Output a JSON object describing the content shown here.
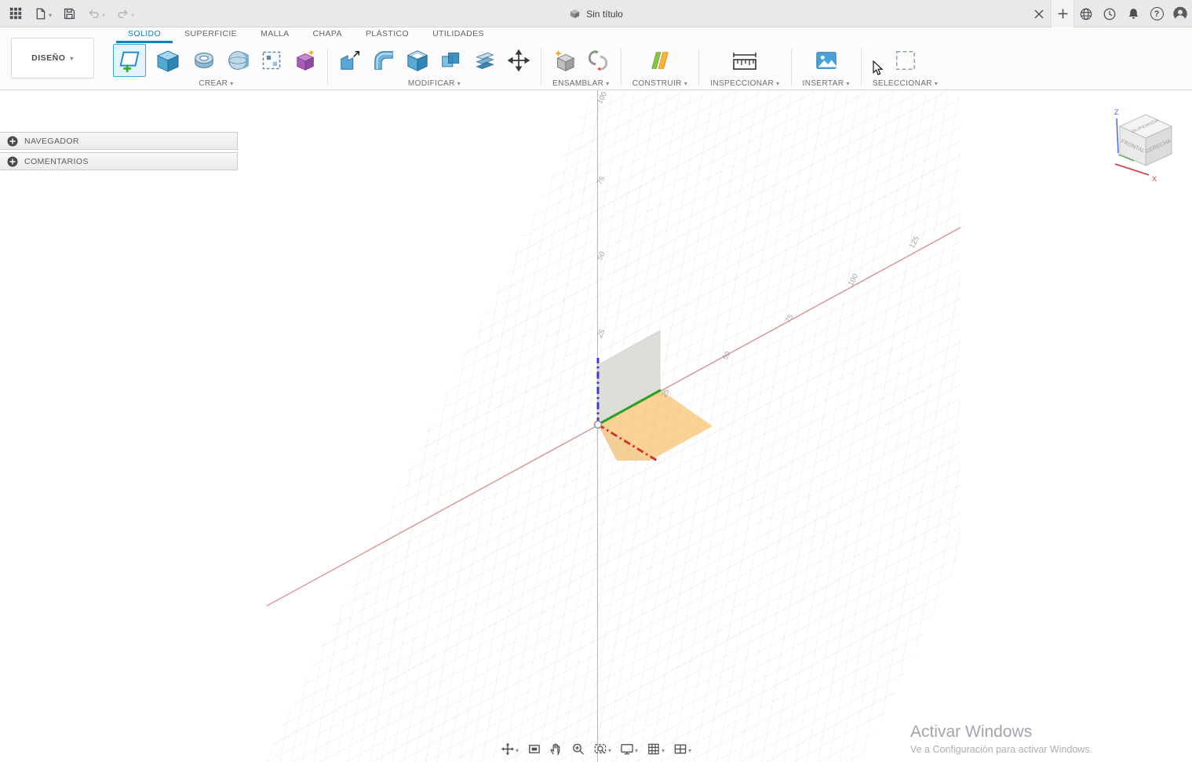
{
  "titlebar": {
    "document_title": "Sin título",
    "help_glyph": "?",
    "left_icons": [
      "apps-grid",
      "file-new",
      "save",
      "undo",
      "redo"
    ],
    "right_icons": [
      "close-document",
      "new-document-tab",
      "extensions",
      "job-status",
      "notifications",
      "help",
      "profile"
    ]
  },
  "toolbar": {
    "design_menu_label": "DISEÑO",
    "tabs": [
      {
        "label": "SOLIDO",
        "active": true
      },
      {
        "label": "SUPERFICIE",
        "active": false
      },
      {
        "label": "MALLA",
        "active": false
      },
      {
        "label": "CHAPA",
        "active": false
      },
      {
        "label": "PLÁSTICO",
        "active": false
      },
      {
        "label": "UTILIDADES",
        "active": false
      }
    ],
    "groups": [
      {
        "label": "CREAR",
        "items": [
          "create-sketch",
          "box",
          "revolve",
          "sphere",
          "pattern",
          "primitive"
        ]
      },
      {
        "label": "MODIFICAR",
        "items": [
          "press-pull",
          "fillet",
          "shell",
          "combine",
          "split-face",
          "move-copy"
        ]
      },
      {
        "label": "ENSAMBLAR",
        "items": [
          "new-component",
          "joint"
        ]
      },
      {
        "label": "CONSTRUIR",
        "items": [
          "construction-plane"
        ]
      },
      {
        "label": "INSPECCIONAR",
        "items": [
          "measure"
        ]
      },
      {
        "label": "INSERTAR",
        "items": [
          "insert-image"
        ]
      },
      {
        "label": "SELECCIONAR",
        "items": [
          "select"
        ]
      }
    ]
  },
  "left_panels": {
    "navegador": "NAVEGADOR",
    "comentarios": "COMENTARIOS"
  },
  "viewport": {
    "green_ticks": {
      "t25": "25",
      "t50": "50",
      "t75": "75",
      "t100": "100"
    },
    "red_ticks": {
      "t25": "25",
      "t50": "50",
      "t75": "75",
      "t100": "100",
      "t125": "125"
    },
    "viewcube": {
      "top": "SUPERIOR",
      "front": "FRONTAL",
      "right": "DERECHA",
      "z": "Z",
      "x": "X"
    },
    "nav_items": [
      "orbit",
      "look-at",
      "pan",
      "zoom",
      "fit",
      "display-settings",
      "grid-settings",
      "viewports"
    ]
  },
  "watermark": {
    "title": "Activar Windows",
    "subtitle": "Ve a Configuración para activar Windows."
  },
  "colors": {
    "accent_blue": "#0a85c7",
    "axis_red": "#d63232",
    "axis_green": "#27a327",
    "axis_blue": "#3b3bd6",
    "plane_orange": "#f4a62a"
  }
}
